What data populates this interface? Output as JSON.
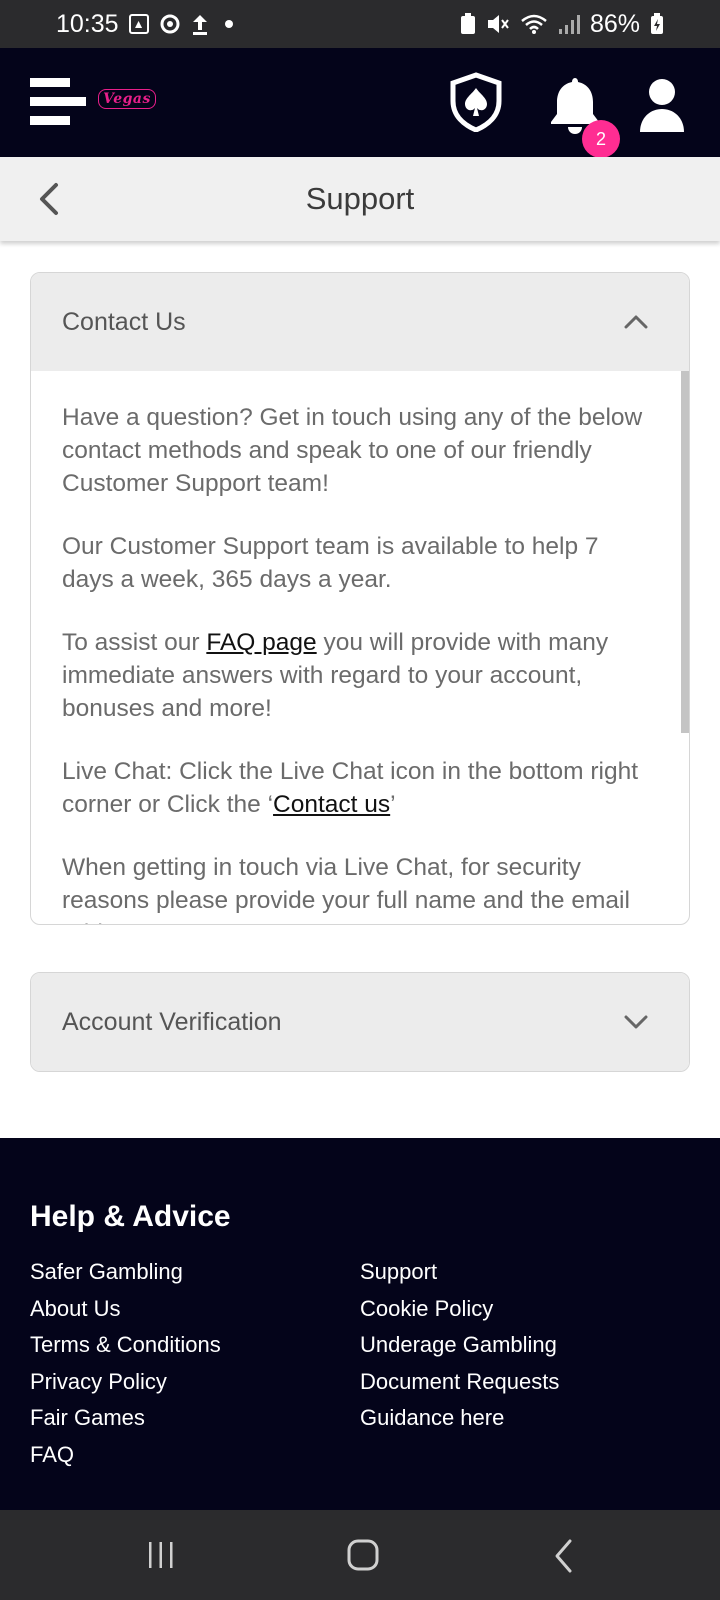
{
  "status_bar": {
    "time": "10:35",
    "battery": "86%",
    "left_icons": [
      "gallery-icon",
      "sync-icon",
      "upload-icon",
      "dot-icon"
    ],
    "right_icons": [
      "battery-saver-icon",
      "mute-icon",
      "wifi-icon",
      "signal-icon",
      "battery-icon"
    ]
  },
  "header": {
    "logo_text": "Vegas",
    "notification_count": "2",
    "icons": [
      "menu-icon",
      "shield-spade-icon",
      "bell-icon",
      "user-icon"
    ]
  },
  "page": {
    "title": "Support"
  },
  "accordions": [
    {
      "title": "Contact Us",
      "expanded": true,
      "paragraphs": [
        "Have a question? Get in touch using any of the below contact methods and speak to one of our friendly Customer Support team!",
        "Our Customer Support team is available to help 7 days a week, 365 days a year."
      ],
      "faq_para": {
        "before": "To assist our ",
        "link": "FAQ page",
        "after": " you will provide with many immediate answers with regard to your account, bonuses and more!"
      },
      "chat_para": {
        "before": "Live Chat: Click the Live Chat icon in the bottom right corner or Click the ‘",
        "link": "Contact us",
        "after": "’"
      },
      "security_para": "When getting in touch via Live Chat, for security reasons please provide your full name and the email address on your account."
    },
    {
      "title": "Account Verification",
      "expanded": false
    }
  ],
  "footer": {
    "title": "Help & Advice",
    "left_links": [
      "Safer Gambling",
      "About Us",
      "Terms & Conditions",
      "Privacy Policy",
      "Fair Games",
      "FAQ"
    ],
    "right_links": [
      "Support",
      "Cookie Policy",
      "Underage Gambling",
      "Document Requests",
      "Guidance here"
    ]
  },
  "nav_bar": {
    "buttons": [
      "recent-apps-icon",
      "home-icon",
      "back-icon"
    ]
  },
  "colors": {
    "header_bg": "#04041a",
    "badge": "#ff2d92",
    "logo": "#e81f8a",
    "system_bar": "#2b2b2d"
  }
}
